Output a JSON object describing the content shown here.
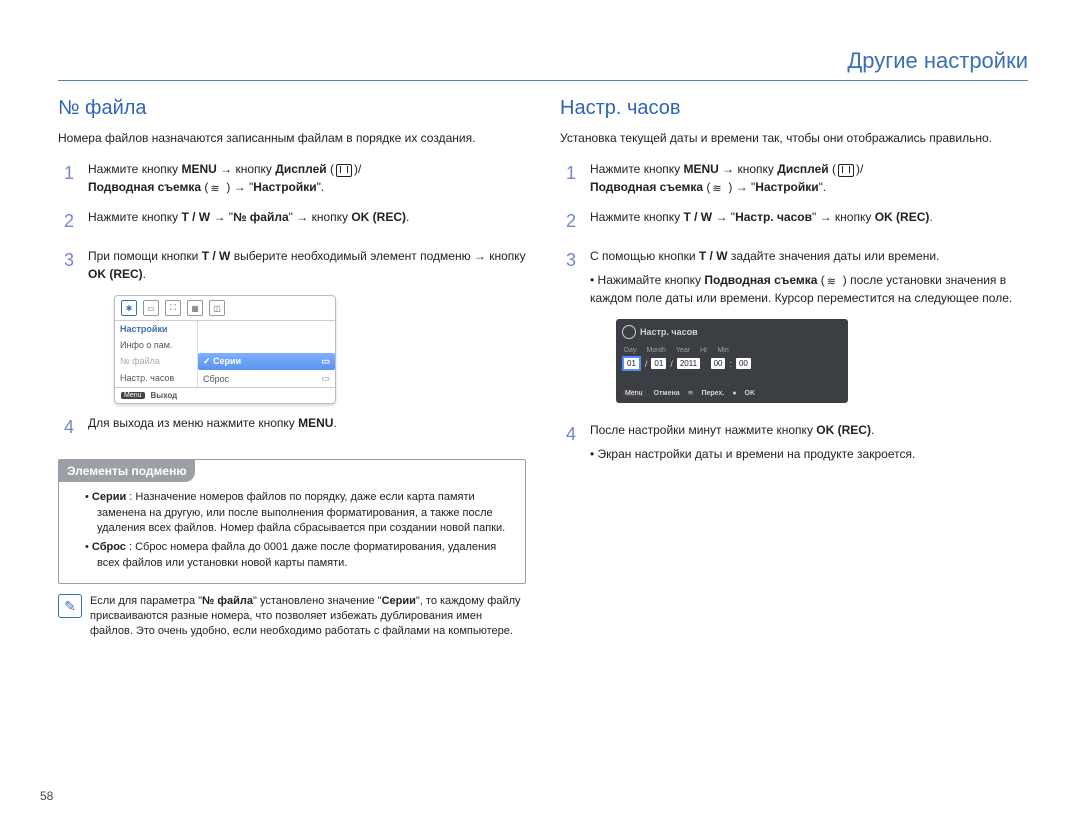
{
  "header": {
    "title": "Другие настройки"
  },
  "page_number": "58",
  "left": {
    "heading": "№ файла",
    "lead": "Номера файлов назначаются записанным файлам в порядке их создания.",
    "steps": {
      "s1_a": "Нажмите кнопку ",
      "s1_menu": "MENU",
      "s1_b": " кнопку ",
      "s1_disp": "Дисплей",
      "s1_c": "Подводная съемка",
      "s1_d": " → \"",
      "s1_set": "Настройки",
      "s1_e": "\".",
      "s2_a": "Нажмите кнопку ",
      "s2_tw": "T / W",
      "s2_b": " → \"",
      "s2_no": "№ файла",
      "s2_c": "\" → кнопку ",
      "s2_ok": "OK (REC)",
      "s2_d": ".",
      "s3_a": "При помощи кнопки ",
      "s3_tw": "T / W",
      "s3_b": " выберите необходимый элемент подменю → кнопку ",
      "s3_ok": "OK (REC)",
      "s3_c": ".",
      "s4_a": "Для выхода из меню нажмите кнопку ",
      "s4_menu": "MENU",
      "s4_b": "."
    },
    "ui": {
      "menu_items": [
        "Настройки",
        "Инфо о пам.",
        "№ файла",
        "Настр. часов"
      ],
      "right_items": [
        "Серии",
        "Сброс"
      ],
      "selected_left": "Настройки",
      "selected_right": "Серии",
      "footer_chip": "Menu",
      "footer_text": "Выход"
    },
    "sub": {
      "title": "Элементы подменю",
      "series_label": "Серии",
      "series_text": " : Назначение номеров файлов по порядку, даже если карта памяти заменена на другую, или после выполнения форматирования, а также после удаления всех файлов. Номер файла сбрасывается при создании новой папки.",
      "reset_label": "Сброс",
      "reset_text": " : Сброс номера файла до 0001 даже после форматирования, удаления всех файлов или установки новой карты памяти."
    },
    "note_a": "Если для параметра \"",
    "note_n1": "№ файла",
    "note_b": "\" установлено значение \"",
    "note_n2": "Серии",
    "note_c": "\", то каждому файлу присваиваются разные номера, что позволяет избежать дублирования имен файлов. Это очень удобно, если необходимо работать с файлами на компьютере."
  },
  "right": {
    "heading": "Настр. часов",
    "lead": "Установка текущей даты и времени так, чтобы они отображались правильно.",
    "steps": {
      "s1_a": "Нажмите кнопку ",
      "s1_menu": "MENU",
      "s1_b": " кнопку ",
      "s1_disp": "Дисплей",
      "s1_c": "Подводная съемка",
      "s1_d": " → \"",
      "s1_set": "Настройки",
      "s1_e": "\".",
      "s2_a": "Нажмите кнопку ",
      "s2_tw": "T / W",
      "s2_b": " → \"",
      "s2_clk": "Настр. часов",
      "s2_c": "\" → кнопку ",
      "s2_ok": "OK (REC)",
      "s2_d": ".",
      "s3_a": "С помощью кнопки ",
      "s3_tw": "T / W",
      "s3_b": " задайте значения даты или времени.",
      "s3_bul_a": "Нажимайте кнопку ",
      "s3_bul_b": "Подводная съемка",
      "s3_bul_c": " после установки значения в каждом поле даты или времени. Курсор переместится на следующее поле.",
      "s4_a": "После настройки минут нажмите кнопку ",
      "s4_ok": "OK (REC)",
      "s4_b": ".",
      "s4_bul": "Экран настройки даты и времени на продукте закроется."
    },
    "clock": {
      "title": "Настр. часов",
      "labels": [
        "Day",
        "Month",
        "Year",
        "Hr",
        "Min"
      ],
      "values": [
        "01",
        "01",
        "2011",
        "00",
        "00"
      ],
      "foot_chip1": "Menu",
      "foot1": "Отмена",
      "foot2": "Перех.",
      "foot3": "OK"
    }
  }
}
